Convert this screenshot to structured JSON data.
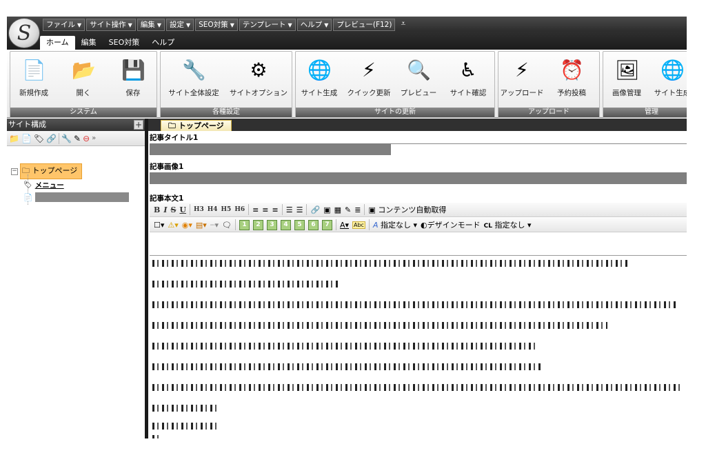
{
  "app": {
    "logo_glyph": "S"
  },
  "quick_menu": [
    {
      "label": "ファイル"
    },
    {
      "label": "サイト操作"
    },
    {
      "label": "編集"
    },
    {
      "label": "設定"
    },
    {
      "label": "SEO対策"
    },
    {
      "label": "テンプレート"
    },
    {
      "label": "ヘルプ"
    },
    {
      "label": "プレビュー(F12)"
    }
  ],
  "quick_menu_more": "⩡",
  "tabs": [
    {
      "label": "ホーム",
      "active": true
    },
    {
      "label": "編集"
    },
    {
      "label": "SEO対策"
    },
    {
      "label": "ヘルプ"
    }
  ],
  "ribbon": {
    "groups": [
      {
        "label": "システム",
        "buttons": [
          {
            "label": "新規作成",
            "icon": "new-document-icon",
            "glyph": "📄"
          },
          {
            "label": "開く",
            "icon": "open-folder-icon",
            "glyph": "📂"
          },
          {
            "label": "保存",
            "icon": "save-disk-icon",
            "glyph": "💾"
          }
        ]
      },
      {
        "label": "各種設定",
        "buttons": [
          {
            "label": "サイト全体設定",
            "icon": "wrench-tools-icon",
            "glyph": "🔧"
          },
          {
            "label": "サイトオプション",
            "icon": "gears-icon",
            "glyph": "⚙"
          }
        ]
      },
      {
        "label": "サイトの更新",
        "buttons": [
          {
            "label": "サイト生成",
            "icon": "globe-generate-icon",
            "glyph": "🌐"
          },
          {
            "label": "クイック更新",
            "icon": "quick-update-icon",
            "glyph": "⚡"
          },
          {
            "label": "プレビュー",
            "icon": "preview-magnifier-icon",
            "glyph": "🔍"
          },
          {
            "label": "サイト確認",
            "icon": "accessibility-check-icon",
            "glyph": "♿"
          }
        ]
      },
      {
        "label": "アップロード",
        "buttons": [
          {
            "label": "アップロード",
            "icon": "upload-lightning-icon",
            "glyph": "⚡"
          },
          {
            "label": "予約投稿",
            "icon": "alarm-clock-icon",
            "glyph": "⏰"
          }
        ]
      },
      {
        "label": "管理",
        "buttons": [
          {
            "label": "画像管理",
            "icon": "image-manager-icon",
            "glyph": "🖼"
          },
          {
            "label": "サイト生成",
            "icon": "site-generate-icon",
            "glyph": "🌐"
          }
        ]
      }
    ]
  },
  "sidebar": {
    "title": "サイト構成",
    "add_glyph": "+",
    "tree_root": "トップページ",
    "tree_children": [
      {
        "label": "メニュー",
        "icon": "tag-icon"
      },
      {
        "label": "",
        "icon": "page-icon"
      }
    ]
  },
  "editor": {
    "page_tab": "トップページ",
    "fields": {
      "title_label": "記事タイトル1",
      "image_label": "記事画像1",
      "body_label": "記事本文1"
    },
    "toolbar1": {
      "bold": "B",
      "italic": "I",
      "strike": "S",
      "underline": "U",
      "h3": "H3",
      "h4": "H4",
      "h5": "H5",
      "h6": "H6",
      "auto_fetch": "コンテンツ自動取得"
    },
    "toolbar2": {
      "numbers": [
        "1",
        "2",
        "3",
        "4",
        "5",
        "6",
        "7"
      ],
      "abc": "Abc",
      "font_none": "指定なし",
      "design_mode": "デザインモード",
      "class_none": "指定なし"
    }
  }
}
